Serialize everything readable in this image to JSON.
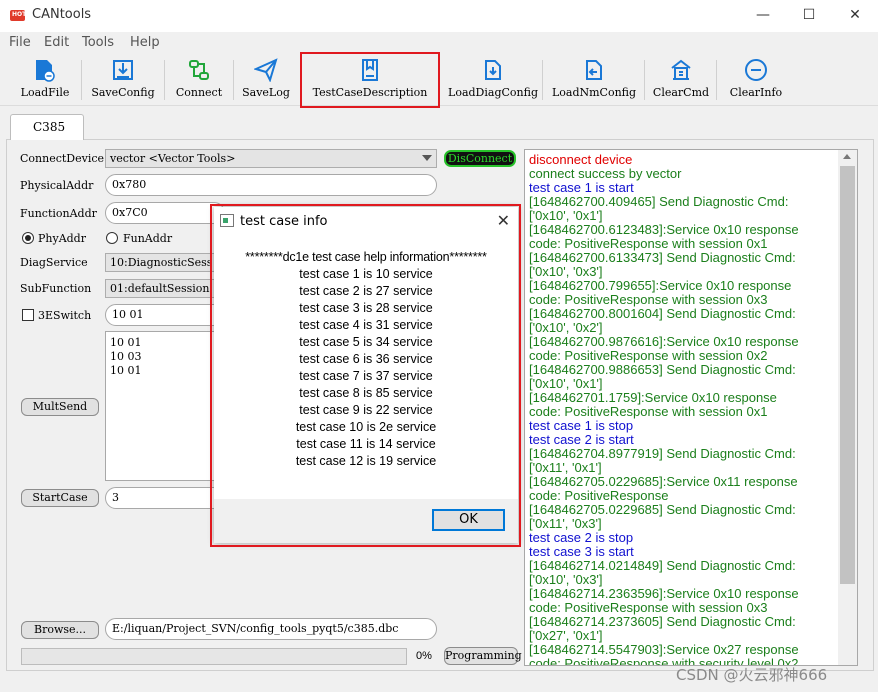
{
  "window": {
    "title": "CANtools",
    "app_icon_text": "HOT"
  },
  "menu": [
    "File",
    "Edit",
    "Tools",
    "Help"
  ],
  "toolbar": [
    {
      "label": "LoadFile",
      "icon": "load-file-icon"
    },
    {
      "label": "SaveConfig",
      "icon": "save-config-icon"
    },
    {
      "label": "Connect",
      "icon": "connect-icon"
    },
    {
      "label": "SaveLog",
      "icon": "paper-plane-icon"
    },
    {
      "label": "TestCaseDescription",
      "icon": "book-icon"
    },
    {
      "label": "LoadDiagConfig",
      "icon": "load-diag-config-icon"
    },
    {
      "label": "LoadNmConfig",
      "icon": "load-nm-config-icon"
    },
    {
      "label": "ClearCmd",
      "icon": "clear-cmd-icon"
    },
    {
      "label": "ClearInfo",
      "icon": "clear-info-icon"
    }
  ],
  "tab": "C385",
  "form": {
    "connect_device_label": "ConnectDevice",
    "connect_device_value": "vector <Vector Tools>",
    "disconnect_label": "DisConnect",
    "physical_addr_label": "PhysicalAddr",
    "physical_addr_value": "0x780",
    "function_addr_label": "FunctionAddr",
    "function_addr_value": "0x7C0",
    "phy_addr_radio": "PhyAddr",
    "fun_addr_radio": "FunAddr",
    "diag_service_label": "DiagService",
    "diag_service_value": "10:DiagnosticSess",
    "sub_function_label": "SubFunction",
    "sub_function_value": "01:defaultSession",
    "three_e_switch_label": "3ESwitch",
    "three_e_value": "10 01",
    "multi_lines": [
      "10 01",
      "10 03",
      "10 01"
    ],
    "mult_send_label": "MultSend",
    "start_case_label": "StartCase",
    "start_case_value": "3",
    "browse_label": "Browse...",
    "browse_path": "E:/liquan/Project_SVN/config_tools_pyqt5/c385.dbc",
    "progress_text": "0%",
    "programming_label": "Programming"
  },
  "colors": {
    "red": "#e00000",
    "green": "#1b7f1b",
    "blue": "#1010d0"
  },
  "log": [
    {
      "text": "disconnect device",
      "color": "red"
    },
    {
      "text": "connect success by vector",
      "color": "green"
    },
    {
      "text": "test case 1 is start",
      "color": "blue"
    },
    {
      "text": "[1648462700.409465] Send Diagnostic Cmd:",
      "color": "green"
    },
    {
      "text": "['0x10', '0x1']",
      "color": "green"
    },
    {
      "text": "[1648462700.6123483]:Service 0x10 response",
      "color": "green"
    },
    {
      "text": "code: PositiveResponse with session 0x1",
      "color": "green"
    },
    {
      "text": "[1648462700.6133473] Send Diagnostic Cmd:",
      "color": "green"
    },
    {
      "text": "['0x10', '0x3']",
      "color": "green"
    },
    {
      "text": "[1648462700.799655]:Service 0x10 response",
      "color": "green"
    },
    {
      "text": "code: PositiveResponse with session 0x3",
      "color": "green"
    },
    {
      "text": "[1648462700.8001604] Send Diagnostic Cmd:",
      "color": "green"
    },
    {
      "text": "['0x10', '0x2']",
      "color": "green"
    },
    {
      "text": "[1648462700.9876616]:Service 0x10 response",
      "color": "green"
    },
    {
      "text": "code: PositiveResponse with session 0x2",
      "color": "green"
    },
    {
      "text": "[1648462700.9886653] Send Diagnostic Cmd:",
      "color": "green"
    },
    {
      "text": "['0x10', '0x1']",
      "color": "green"
    },
    {
      "text": "[1648462701.1759]:Service 0x10 response",
      "color": "green"
    },
    {
      "text": "code: PositiveResponse with session 0x1",
      "color": "green"
    },
    {
      "text": "test case 1 is stop",
      "color": "blue"
    },
    {
      "text": "test case 2 is start",
      "color": "blue"
    },
    {
      "text": "[1648462704.8977919] Send Diagnostic Cmd:",
      "color": "green"
    },
    {
      "text": "['0x11', '0x1']",
      "color": "green"
    },
    {
      "text": "[1648462705.0229685]:Service 0x11 response",
      "color": "green"
    },
    {
      "text": "code: PositiveResponse",
      "color": "green"
    },
    {
      "text": "[1648462705.0229685] Send Diagnostic Cmd:",
      "color": "green"
    },
    {
      "text": "['0x11', '0x3']",
      "color": "green"
    },
    {
      "text": "test case 2 is stop",
      "color": "blue"
    },
    {
      "text": "test case 3 is start",
      "color": "blue"
    },
    {
      "text": "[1648462714.0214849] Send Diagnostic Cmd:",
      "color": "green"
    },
    {
      "text": "['0x10', '0x3']",
      "color": "green"
    },
    {
      "text": "[1648462714.2363596]:Service 0x10 response",
      "color": "green"
    },
    {
      "text": "code: PositiveResponse with session 0x3",
      "color": "green"
    },
    {
      "text": "[1648462714.2373605] Send Diagnostic Cmd:",
      "color": "green"
    },
    {
      "text": "['0x27', '0x1']",
      "color": "green"
    },
    {
      "text": "[1648462714.5547903]:Service 0x27 response",
      "color": "green"
    },
    {
      "text": "code: PositiveResponse with security level 0x2",
      "color": "green"
    }
  ],
  "dialog": {
    "title": "test case info",
    "header": "********dc1e test case help information********",
    "lines": [
      "test case 1 is 10 service",
      "test case 2 is 27 service",
      "test case 3 is 28 service",
      "test case 4 is 31 service",
      "test case 5 is 34 service",
      "test case 6 is 36 service",
      "test case 7 is 37 service",
      "test case 8 is 85 service",
      "test case 9 is 22 service",
      "test case 10 is 2e service",
      "test case 11 is 14 service",
      "test case 12 is 19 service"
    ],
    "ok_label": "OK"
  },
  "watermark": "CSDN @火云邪神666"
}
